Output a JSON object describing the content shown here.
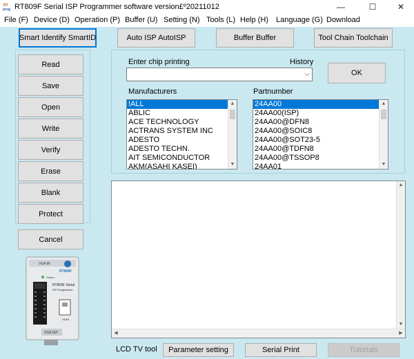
{
  "window": {
    "icon_text": "RT\nprog",
    "title": "RT809F Serial ISP Programmer software version£º20211012",
    "minimize": "—",
    "maximize": "☐",
    "close": "✕"
  },
  "menu": [
    "File (F)",
    "Device (D)",
    "Operation (P)",
    "Buffer (U)",
    "Setting (N)",
    "Tools (L)",
    "Help (H)",
    "Language (G)",
    "Download"
  ],
  "toolbar": {
    "smart_identify": "Smart Identify SmartID",
    "auto_isp": "Auto ISP AutoISP",
    "buffer": "Buffer Buffer",
    "tool_chain": "Tool Chain Toolchain"
  },
  "actions": [
    "Read",
    "Save",
    "Open",
    "Write",
    "Verify",
    "Erase",
    "Blank",
    "Protect"
  ],
  "cancel": "Cancel",
  "chip": {
    "enter_label": "Enter chip printing",
    "history_label": "History",
    "combo_value": "",
    "ok": "OK"
  },
  "manufacturers": {
    "label": "Manufacturers",
    "items": [
      "!ALL",
      "ABLIC",
      "ACE TECHNOLOGY",
      "ACTRANS SYSTEM INC",
      "ADESTO",
      "ADESTO TECHN.",
      "AIT SEMICONDUCTOR",
      "AKM(ASAHI KASEI)"
    ],
    "selected_index": 0
  },
  "partnumbers": {
    "label": "Partnumber",
    "items": [
      "24AA00",
      "24AA00(ISP)",
      "24AA00@DFN8",
      "24AA00@SOIC8",
      "24AA00@SOT23-5",
      "24AA00@TDFN8",
      "24AA00@TSSOP8",
      "24AA01"
    ],
    "selected_index": 0
  },
  "bottom": {
    "lcd_label": "LCD TV tool",
    "parameter_setting": "Parameter setting",
    "serial_print": "Serial Print",
    "tutorials": "Tutorials"
  },
  "device_image": {
    "top_label": "VGA IN",
    "brand": "RT809F Serial",
    "subtitle": "ISP Programmer",
    "bottom_label": "VGA ISP",
    "side_label": "HDMI",
    "led_label": "Station"
  },
  "colors": {
    "background": "#c9e8ef",
    "selection": "#0078d7",
    "button_face": "#e1e1e1"
  }
}
